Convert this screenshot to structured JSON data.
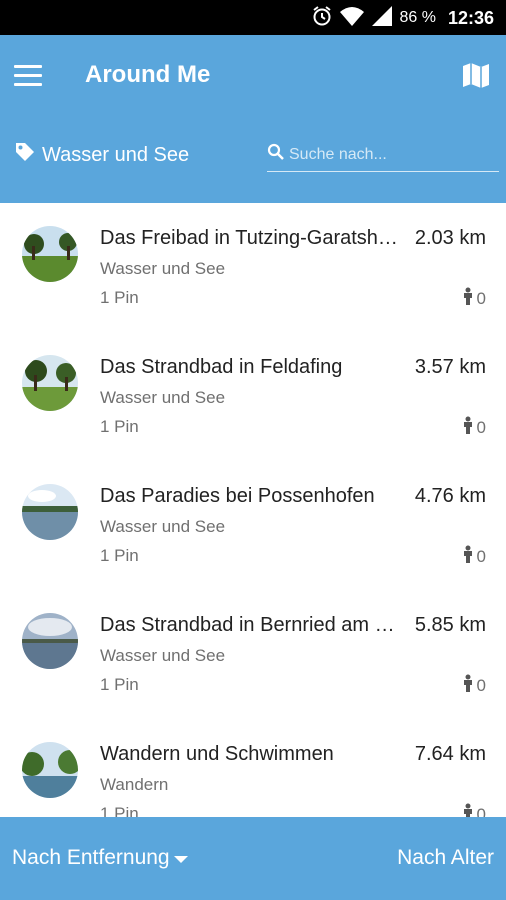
{
  "status_bar": {
    "battery": "86 %",
    "time": "12:36",
    "icons": [
      "alarm-icon",
      "wifi-icon",
      "signal-icon",
      "battery-icon"
    ]
  },
  "app_bar": {
    "title": "Around Me",
    "menu_icon": "hamburger-menu-icon",
    "map_icon": "map-icon",
    "filter_label": "Wasser und See",
    "search_placeholder": "Suche nach..."
  },
  "places": [
    {
      "name": "Das Freibad in Tutzing-Garatshausen",
      "distance": "2.03 km",
      "category": "Wasser und See",
      "pins": "1 Pin",
      "visitors": "0"
    },
    {
      "name": "Das Strandbad in Feldafing",
      "distance": "3.57 km",
      "category": "Wasser und See",
      "pins": "1 Pin",
      "visitors": "0"
    },
    {
      "name": "Das Paradies bei Possenhofen",
      "distance": "4.76 km",
      "category": "Wasser und See",
      "pins": "1 Pin",
      "visitors": "0"
    },
    {
      "name": "Das Strandbad in Bernried am Starnberger See",
      "distance": "5.85 km",
      "category": "Wasser und See",
      "pins": "1 Pin",
      "visitors": "0"
    },
    {
      "name": "Wandern und Schwimmen",
      "distance": "7.64 km",
      "category": "Wandern",
      "pins": "1 Pin",
      "visitors": "0"
    }
  ],
  "bottom_bar": {
    "sort_distance": "Nach Entfernung",
    "sort_age": "Nach Alter"
  },
  "colors": {
    "primary": "#5aa6dc",
    "status_bar": "#000000",
    "text_primary": "#222222",
    "text_secondary": "#707070"
  }
}
